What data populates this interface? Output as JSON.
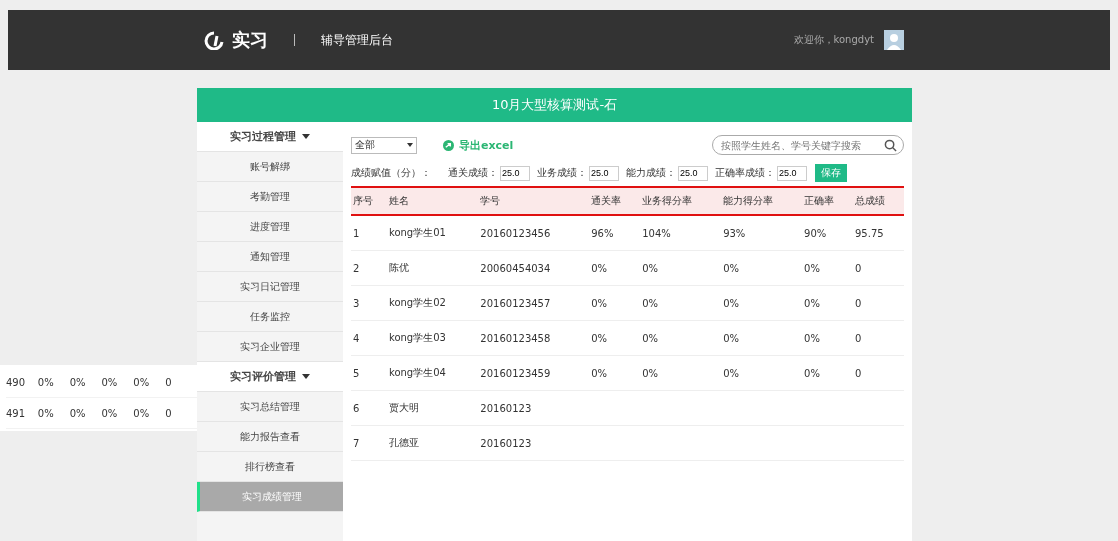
{
  "header": {
    "logo": "实习",
    "subtitle": "辅导管理后台",
    "welcome": "欢迎你，kongdyt"
  },
  "title": "10月大型核算测试-石",
  "sidebar": [
    {
      "label": "实习过程管理",
      "kind": "group",
      "selected": false
    },
    {
      "label": "账号解绑",
      "kind": "item",
      "selected": false
    },
    {
      "label": "考勤管理",
      "kind": "item",
      "selected": false
    },
    {
      "label": "进度管理",
      "kind": "item",
      "selected": false
    },
    {
      "label": "通知管理",
      "kind": "item",
      "selected": false
    },
    {
      "label": "实习日记管理",
      "kind": "item",
      "selected": false
    },
    {
      "label": "任务监控",
      "kind": "item",
      "selected": false
    },
    {
      "label": "实习企业管理",
      "kind": "item",
      "selected": false
    },
    {
      "label": "实习评价管理",
      "kind": "group",
      "selected": false
    },
    {
      "label": "实习总结管理",
      "kind": "item",
      "selected": false
    },
    {
      "label": "能力报告查看",
      "kind": "item",
      "selected": false
    },
    {
      "label": "排行榜查看",
      "kind": "item",
      "selected": false
    },
    {
      "label": "实习成绩管理",
      "kind": "item",
      "selected": true
    }
  ],
  "toolbar": {
    "filter": "全部",
    "export": "导出excel",
    "search_placeholder": "按照学生姓名、学号关键字搜索"
  },
  "weights": {
    "label": "成绩赋值（分）：",
    "items": [
      {
        "label": "通关成绩：",
        "value": "25.0"
      },
      {
        "label": "业务成绩：",
        "value": "25.0"
      },
      {
        "label": "能力成绩：",
        "value": "25.0"
      },
      {
        "label": "正确率成绩：",
        "value": "25.0"
      }
    ],
    "save": "保存"
  },
  "table": {
    "columns": [
      "序号",
      "姓名",
      "学号",
      "通关率",
      "业务得分率",
      "能力得分率",
      "正确率",
      "总成绩"
    ],
    "rows": [
      [
        "1",
        "kong学生01",
        "20160123456",
        "96%",
        "104%",
        "93%",
        "90%",
        "95.75"
      ],
      [
        "2",
        "陈优",
        "20060454034",
        "0%",
        "0%",
        "0%",
        "0%",
        "0"
      ],
      [
        "3",
        "kong学生02",
        "20160123457",
        "0%",
        "0%",
        "0%",
        "0%",
        "0"
      ],
      [
        "4",
        "kong学生03",
        "20160123458",
        "0%",
        "0%",
        "0%",
        "0%",
        "0"
      ],
      [
        "5",
        "kong学生04",
        "20160123459",
        "0%",
        "0%",
        "0%",
        "0%",
        "0"
      ],
      [
        "6",
        "贾大明",
        "20160123",
        "",
        "",
        "",
        "",
        ""
      ],
      [
        "7",
        "孔德亚",
        "20160123",
        "",
        "",
        "",
        "",
        ""
      ]
    ]
  },
  "fragment_rows": [
    [
      "490",
      "0%",
      "0%",
      "0%",
      "0%",
      "0"
    ],
    [
      "491",
      "0%",
      "0%",
      "0%",
      "0%",
      "0"
    ]
  ]
}
